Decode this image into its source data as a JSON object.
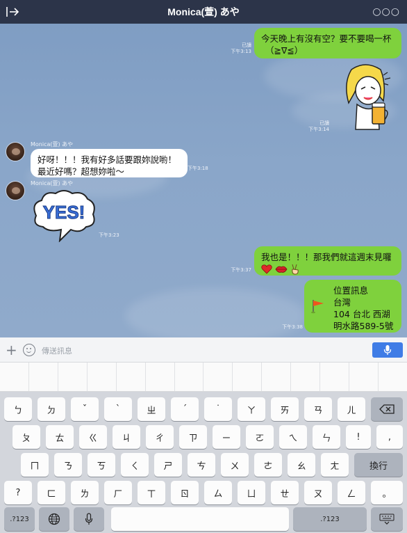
{
  "header": {
    "title": "Monica(萱) あや",
    "more": "○○○"
  },
  "contact_name": "Monica(萱) あや",
  "messages": [
    {
      "side": "right",
      "text_line1": "今天晚上有沒有空？要不要喝一杯",
      "text_line2": "（≧∇≦）",
      "read": "已讀",
      "time": "下午3:13"
    },
    {
      "side": "right",
      "type": "sticker",
      "sticker_name": "girl-with-beer-sticker",
      "read": "已讀",
      "time": "下午3:14"
    },
    {
      "side": "left",
      "text_line1": "好呀！！！我有好多話要跟妳說喲！",
      "text_line2": "最近好嗎？超想妳啦～",
      "time": "下午3:18"
    },
    {
      "side": "left",
      "type": "sticker",
      "sticker_text": "YES!",
      "time": "下午3:23"
    },
    {
      "side": "right",
      "text_line1": "我也是！！！那我們就這週末見囉",
      "emojis": "❤ 💋 ✌",
      "time": "下午3:37"
    },
    {
      "side": "right",
      "type": "location",
      "title": "位置訊息",
      "line1": "台灣",
      "line2": "104 台北 西湖",
      "line3": "明水路589-5號",
      "time": "下午3:38"
    }
  ],
  "input": {
    "placeholder": "傳送訊息",
    "plus": "+"
  },
  "keyboard": {
    "row1": [
      "ㄅ",
      "ㄉ",
      "ˇ",
      "ˋ",
      "ㄓ",
      "ˊ",
      "˙",
      "ㄚ",
      "ㄞ",
      "ㄢ",
      "ㄦ"
    ],
    "row2": [
      "ㄆ",
      "ㄊ",
      "ㄍ",
      "ㄐ",
      "ㄔ",
      "ㄗ",
      "ㄧ",
      "ㄛ",
      "ㄟ",
      "ㄣ",
      "!",
      ","
    ],
    "row3": [
      "ㄇ",
      "ㄋ",
      "ㄎ",
      "ㄑ",
      "ㄕ",
      "ㄘ",
      "ㄨ",
      "ㄜ",
      "ㄠ",
      "ㄤ"
    ],
    "row4": [
      "?",
      "ㄈ",
      "ㄌ",
      "ㄏ",
      "ㄒ",
      "ㄖ",
      "ㄙ",
      "ㄩ",
      "ㄝ",
      "ㄡ",
      "ㄥ",
      "。"
    ],
    "return_label": "換行",
    "num_label": ".?123"
  },
  "colors": {
    "header": "#2c3449",
    "bubble_right": "#7fd13d",
    "bubble_left": "#ffffff",
    "mic": "#3f7ce6"
  }
}
